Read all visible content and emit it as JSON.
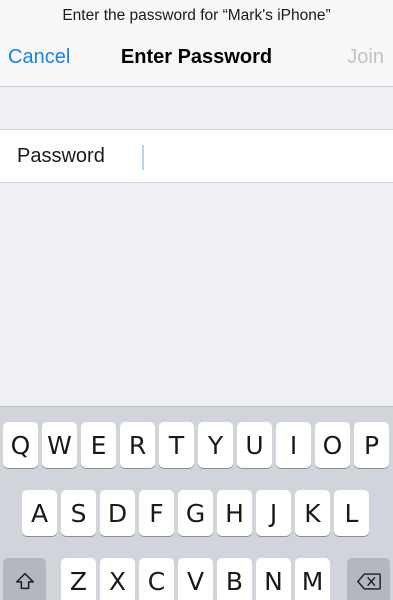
{
  "header": {
    "prompt": "Enter the password for “Mark's iPhone”",
    "cancel_label": "Cancel",
    "title": "Enter Password",
    "join_label": "Join"
  },
  "password_field": {
    "label": "Password",
    "value": "",
    "placeholder": ""
  },
  "keyboard": {
    "row1": [
      "Q",
      "W",
      "E",
      "R",
      "T",
      "Y",
      "U",
      "I",
      "O",
      "P"
    ],
    "row2": [
      "A",
      "S",
      "D",
      "F",
      "G",
      "H",
      "J",
      "K",
      "L"
    ],
    "row3": [
      "Z",
      "X",
      "C",
      "V",
      "B",
      "N",
      "M"
    ],
    "shift_icon": "shift-icon",
    "backspace_icon": "backspace-icon"
  },
  "colors": {
    "accent": "#1a82e0",
    "disabled": "#c3c3c7",
    "background": "#efeff4",
    "keyboard": "#d1d4da"
  }
}
